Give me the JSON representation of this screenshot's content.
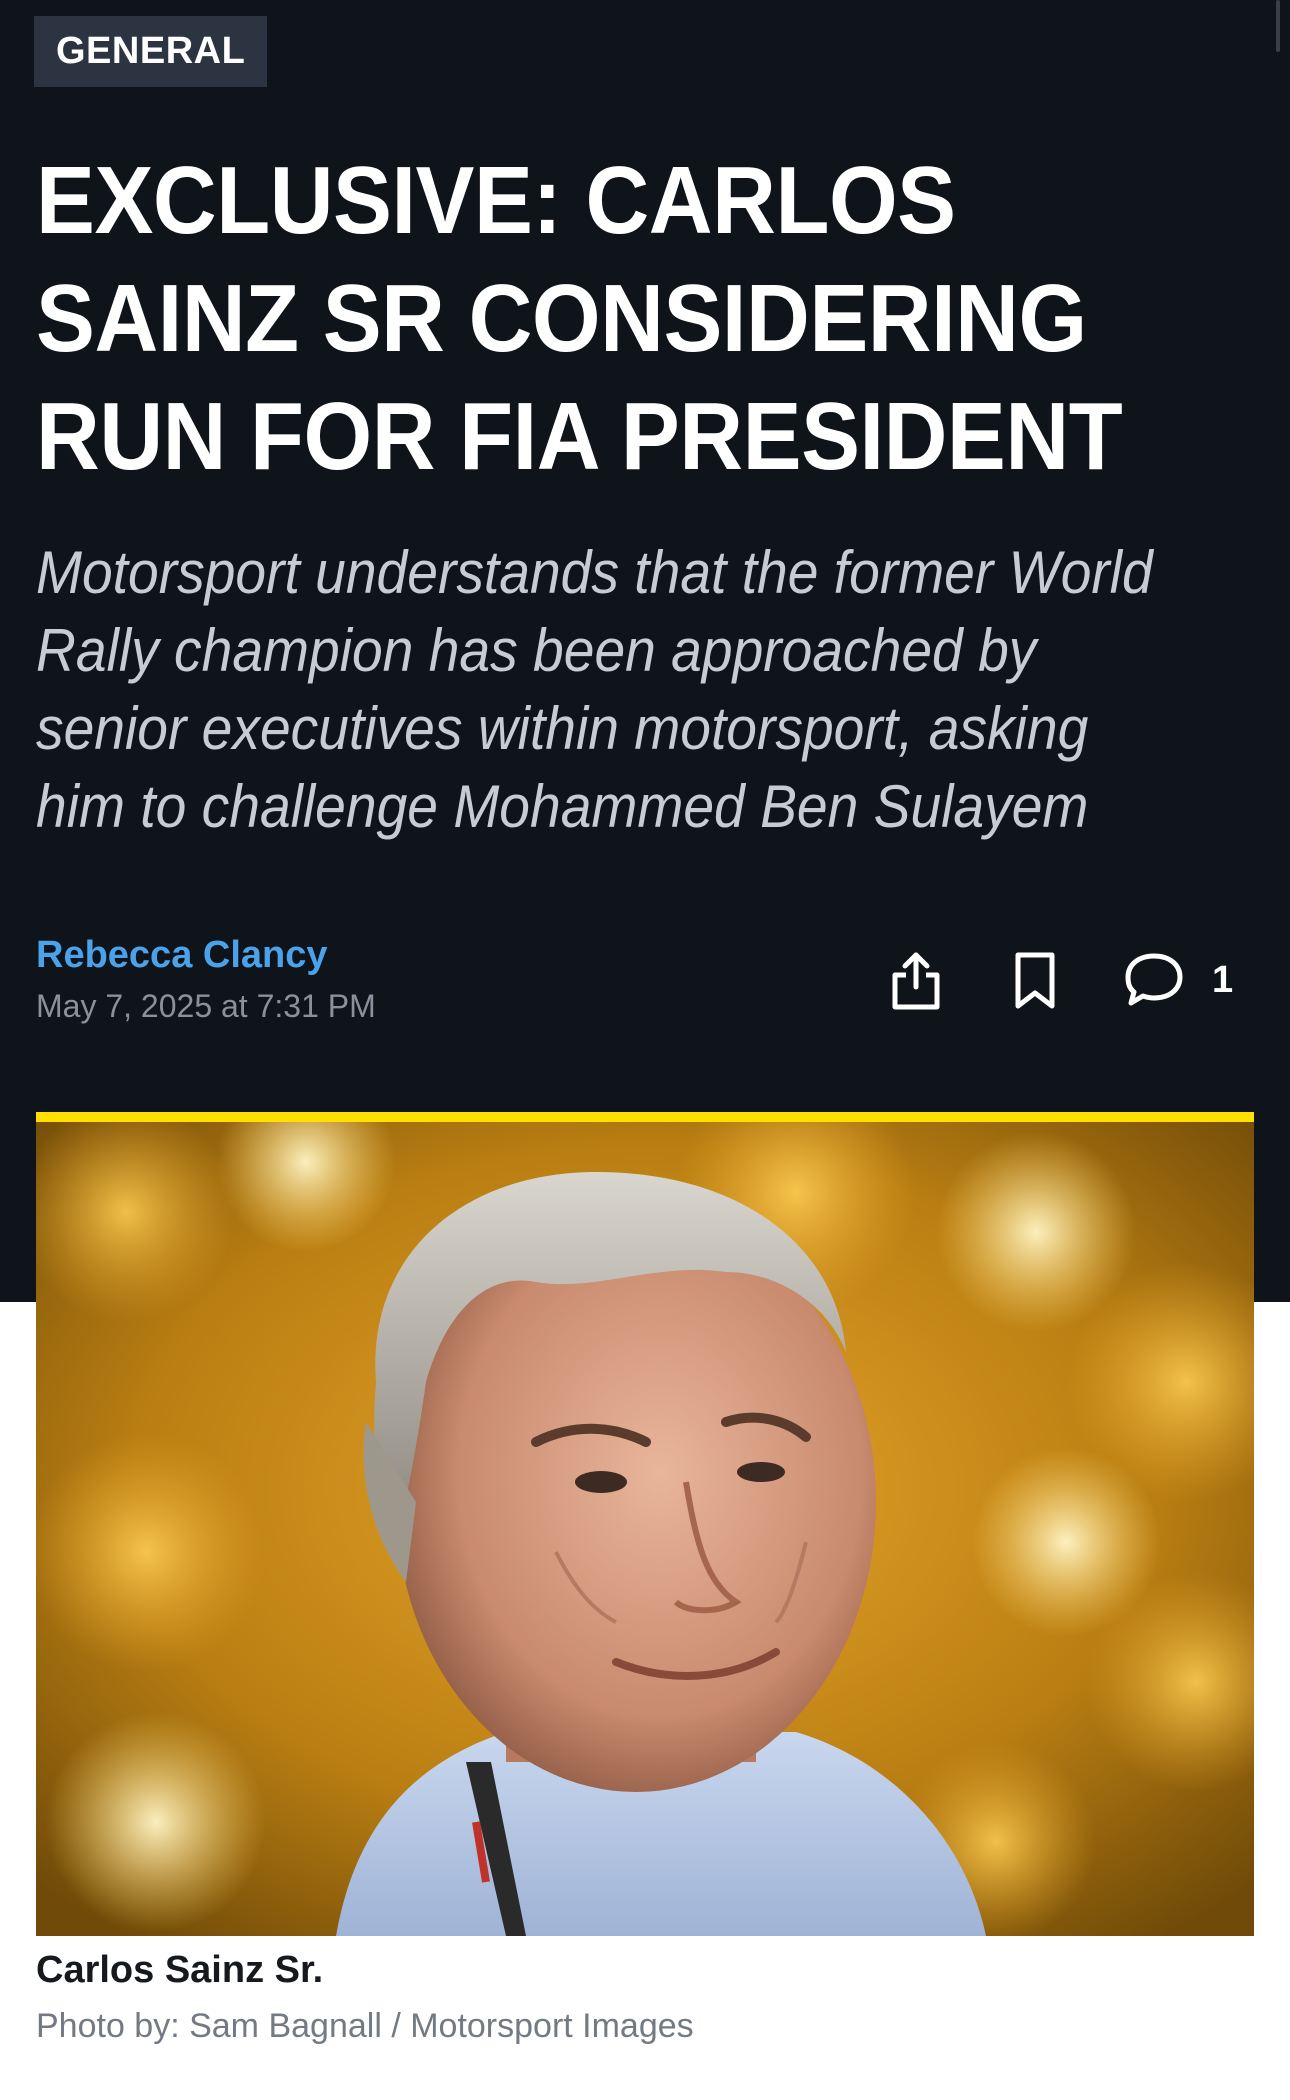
{
  "article": {
    "category": "GENERAL",
    "headline": "EXCLUSIVE: CARLOS SAINZ SR CONSIDERING RUN FOR FIA PRESIDENT",
    "standfirst": "Motorsport understands that the former World Rally champion has been approached by senior executives within motorsport, asking him to challenge Mohammed Ben Sulayem",
    "author": "Rebecca Clancy",
    "date": "May 7, 2025 at 7:31 PM"
  },
  "actions": {
    "share_icon": "share-icon",
    "bookmark_icon": "bookmark-icon",
    "comment_icon": "comment-icon",
    "comment_count": "1"
  },
  "image": {
    "caption": "Carlos Sainz Sr.",
    "credit": "Photo by: Sam Bagnall / Motorsport Images"
  },
  "colors": {
    "header_background": "#0f131a",
    "badge_background": "#2b3440",
    "author_link": "#4aa3ea",
    "accent_bar": "#ffe000"
  }
}
